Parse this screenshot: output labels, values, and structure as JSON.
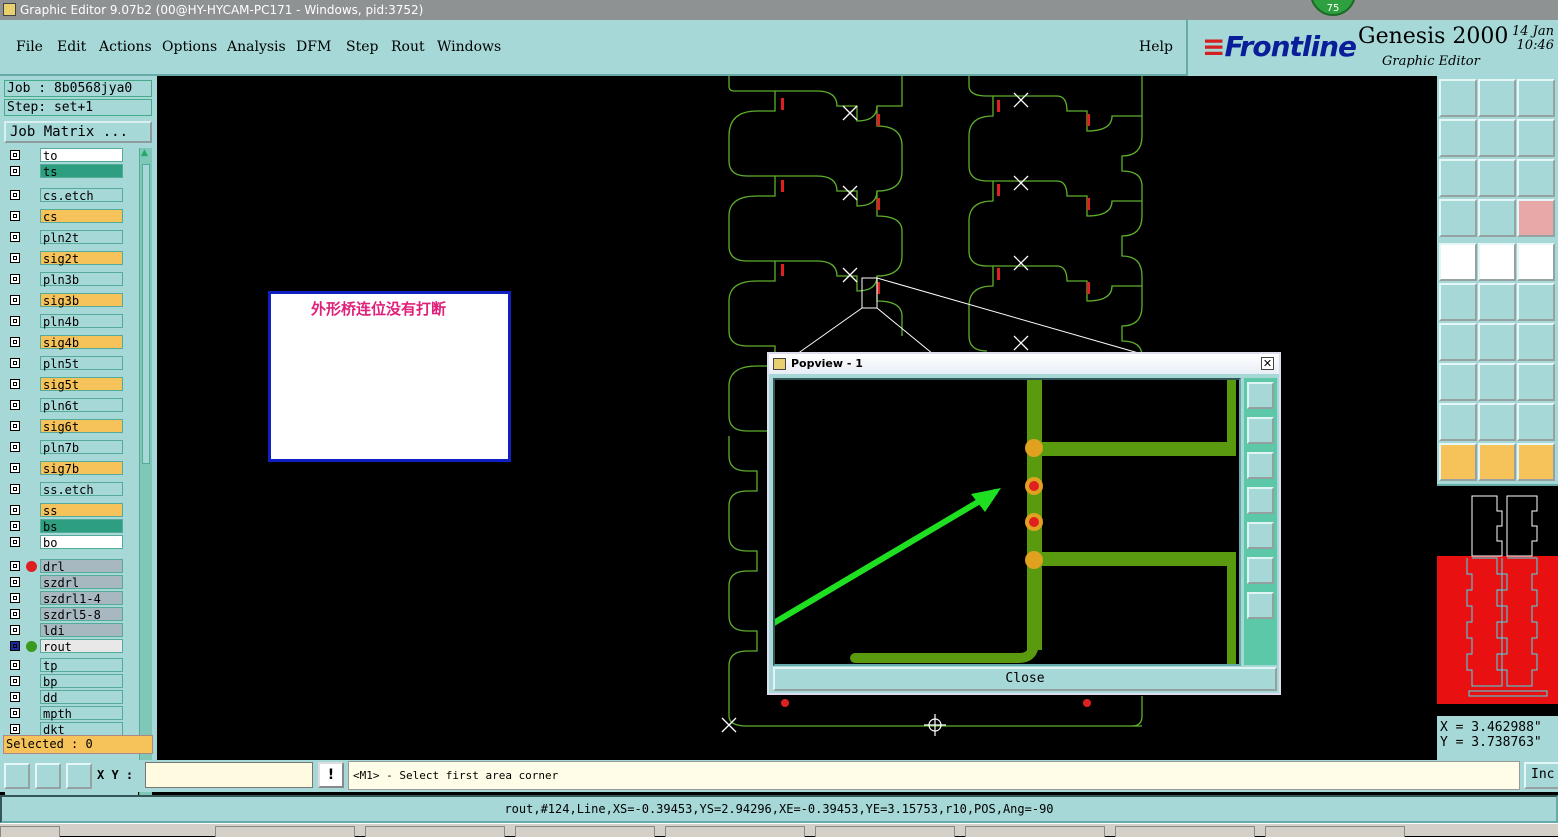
{
  "window": {
    "title": "Graphic Editor 9.07b2 (00@HY-HYCAM-PC171 - Windows, pid:3752)",
    "badge": "75"
  },
  "menu": {
    "items": [
      {
        "label": "File"
      },
      {
        "label": "Edit"
      },
      {
        "label": "Actions"
      },
      {
        "label": "Options"
      },
      {
        "label": "Analysis"
      },
      {
        "label": "DFM"
      },
      {
        "label": "Step"
      },
      {
        "label": "Rout"
      },
      {
        "label": "Windows"
      }
    ],
    "help": "Help"
  },
  "logo": {
    "brand": "Frontline",
    "product": "Genesis 2000",
    "subtitle": "Graphic Editor",
    "date_day": "14 Jan",
    "time": "10:46"
  },
  "job": {
    "job_line": "Job : 8b0568jya0",
    "step_line": "Step: set+1",
    "matrix_button": "Job Matrix ..."
  },
  "layers": [
    {
      "name": "to",
      "color": "#ffffff"
    },
    {
      "name": "ts",
      "color": "#2e9e80"
    },
    {
      "name": "cs.etch",
      "color": "#a6d8d8"
    },
    {
      "name": "cs",
      "color": "#f5c35a"
    },
    {
      "name": "pln2t",
      "color": "#a6d8d8"
    },
    {
      "name": "sig2t",
      "color": "#f5c35a"
    },
    {
      "name": "pln3b",
      "color": "#a6d8d8"
    },
    {
      "name": "sig3b",
      "color": "#f5c35a"
    },
    {
      "name": "pln4b",
      "color": "#a6d8d8"
    },
    {
      "name": "sig4b",
      "color": "#f5c35a"
    },
    {
      "name": "pln5t",
      "color": "#a6d8d8"
    },
    {
      "name": "sig5t",
      "color": "#f5c35a"
    },
    {
      "name": "pln6t",
      "color": "#a6d8d8"
    },
    {
      "name": "sig6t",
      "color": "#f5c35a"
    },
    {
      "name": "pln7b",
      "color": "#a6d8d8"
    },
    {
      "name": "sig7b",
      "color": "#f5c35a"
    },
    {
      "name": "ss.etch",
      "color": "#a6d8d8"
    },
    {
      "name": "ss",
      "color": "#f5c35a"
    },
    {
      "name": "bs",
      "color": "#2e9e80"
    },
    {
      "name": "bo",
      "color": "#ffffff"
    },
    {
      "name": "drl",
      "color": "#a8b8c0",
      "dot": "#e02020"
    },
    {
      "name": "szdrl",
      "color": "#a8b8c0"
    },
    {
      "name": "szdrl1-4",
      "color": "#a8b8c0"
    },
    {
      "name": "szdrl5-8",
      "color": "#a8b8c0"
    },
    {
      "name": "ldi",
      "color": "#a8b8c0"
    },
    {
      "name": "rout",
      "color": "#e8e8e8",
      "dot": "#3a9a20",
      "active": true
    },
    {
      "name": "tp",
      "color": "#a6d8d8"
    },
    {
      "name": "bp",
      "color": "#a6d8d8"
    },
    {
      "name": "dd",
      "color": "#a6d8d8"
    },
    {
      "name": "mpth",
      "color": "#a6d8d8"
    },
    {
      "name": "dkt",
      "color": "#a6d8d8"
    }
  ],
  "selected": "Selected : 0",
  "annotation": {
    "text": "外形桥连位没有打断"
  },
  "popview": {
    "title": "Popview - 1",
    "close_button": "Close",
    "close_x": "✕"
  },
  "coords": {
    "x": "X = 3.462988\"",
    "y": "Y = 3.738763\""
  },
  "input": {
    "xy_label": "X Y :",
    "excl": "!",
    "message": "<M1> - Select first area corner",
    "inc_button": "Inc"
  },
  "status": {
    "text": "rout,#124,Line,XS=-0.39453,YS=2.94296,XE=-0.39453,YE=3.15753,r10,POS,Ang=-90"
  },
  "colors": {
    "panel": "#a6d8d8",
    "layer_active": "#f5c35a",
    "trace": "#5fae2c",
    "pad": "#e0a020",
    "arrow": "#1ee020"
  }
}
